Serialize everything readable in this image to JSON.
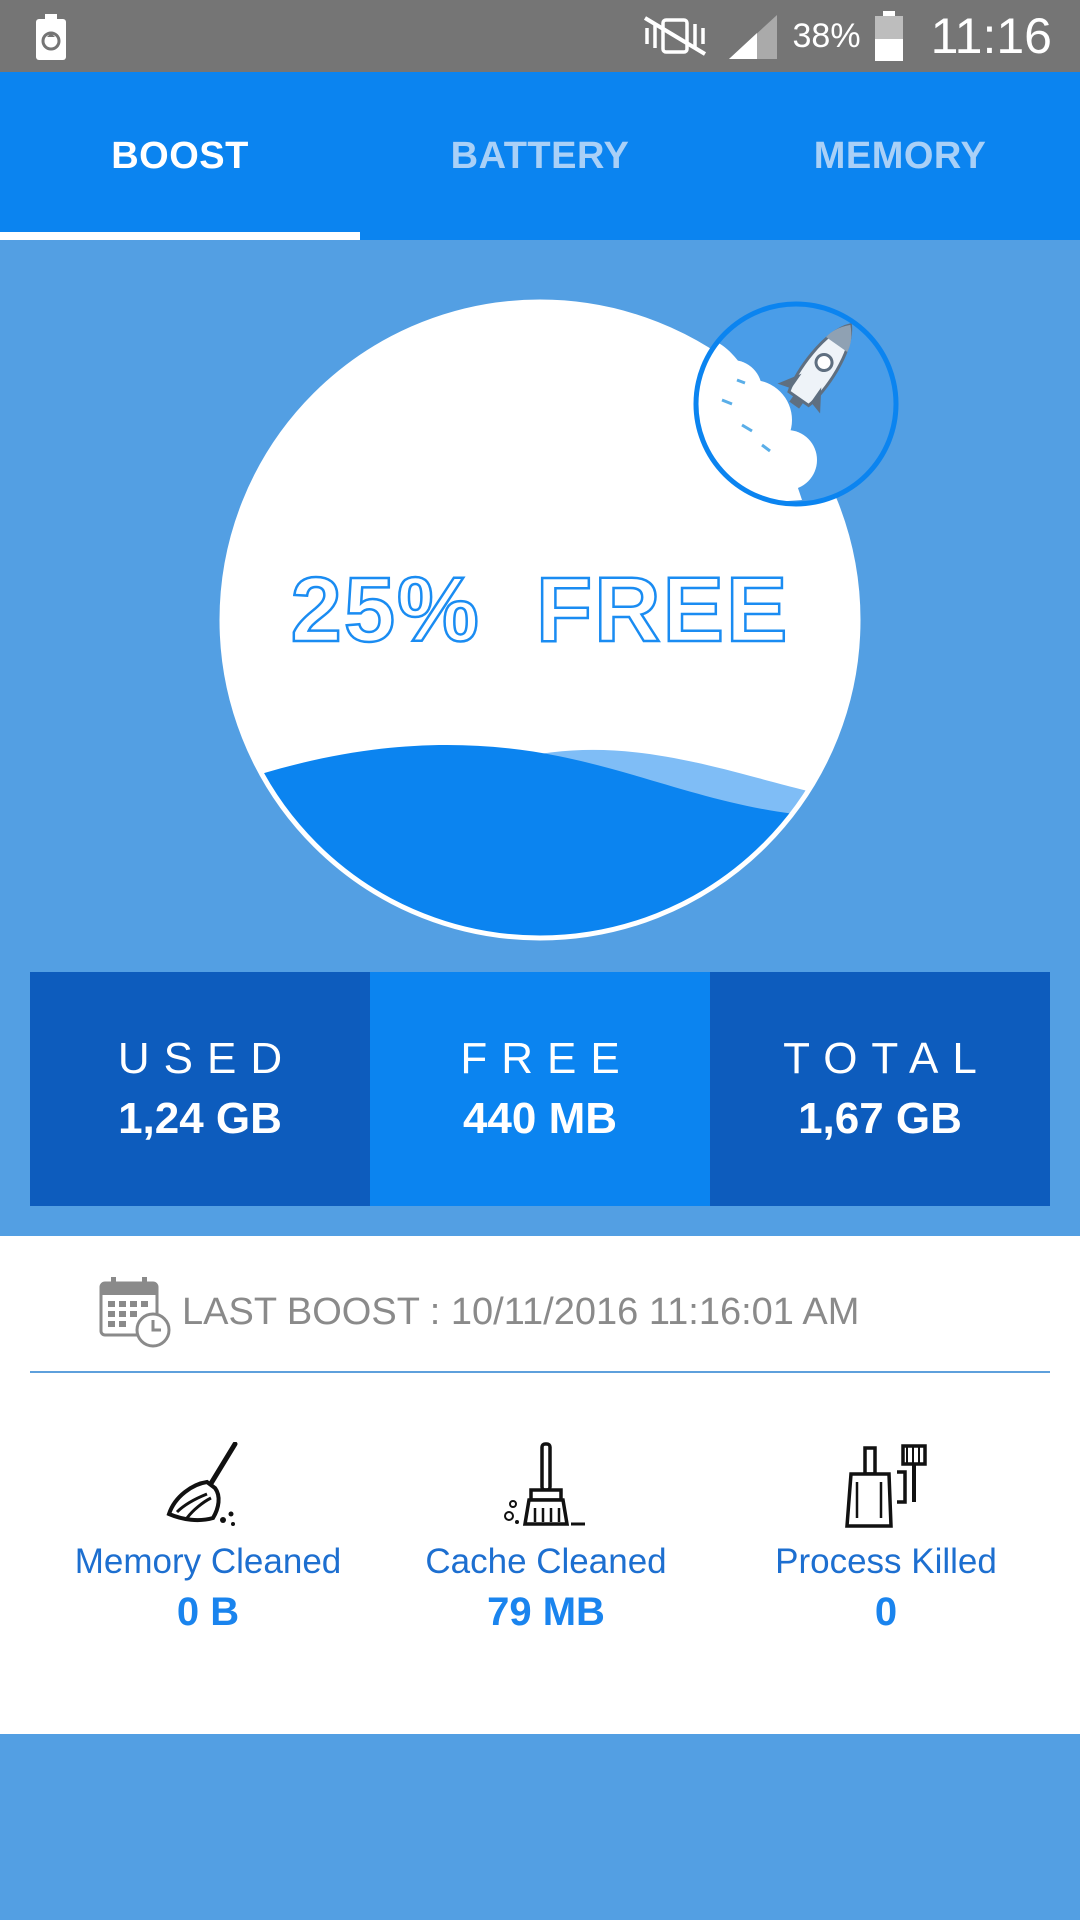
{
  "status_bar": {
    "battery_percent": "38%",
    "time": "11:16"
  },
  "tabs": [
    {
      "label": "BOOST",
      "active": true
    },
    {
      "label": "BATTERY",
      "active": false
    },
    {
      "label": "MEMORY",
      "active": false
    }
  ],
  "gauge": {
    "percent_text": "25%",
    "free_text": "FREE",
    "free_fraction": 0.25
  },
  "stats": {
    "used": {
      "label": "USED",
      "value": "1,24 GB"
    },
    "free": {
      "label": "FREE",
      "value": "440 MB"
    },
    "total": {
      "label": "TOTAL",
      "value": "1,67 GB"
    }
  },
  "last_boost": {
    "label": "LAST BOOST : 10/11/2016 11:16:01 AM"
  },
  "metrics": [
    {
      "label": "Memory Cleaned",
      "value": "0 B",
      "icon": "broom-icon"
    },
    {
      "label": "Cache Cleaned",
      "value": "79 MB",
      "icon": "brush-icon"
    },
    {
      "label": "Process Killed",
      "value": "0",
      "icon": "dustpan-icon"
    }
  ],
  "colors": {
    "tab_bar": "#0b84f0",
    "background": "#539fe3",
    "stat_dark": "#0d5cbd",
    "accent": "#1a84ee"
  }
}
